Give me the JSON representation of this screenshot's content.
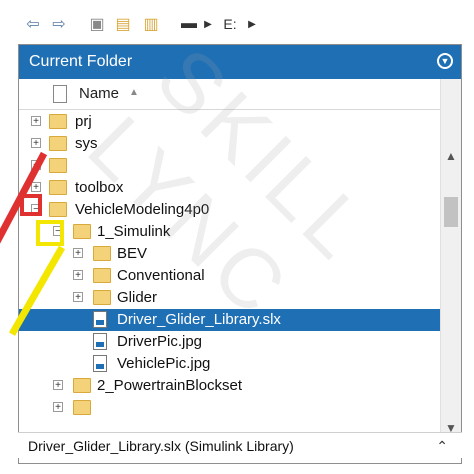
{
  "toolbar": {
    "back_icon": "back-arrow",
    "forward_icon": "forward-arrow",
    "up_icon": "folder-up",
    "browse_icon": "browse-folder",
    "search_icon": "search-folder",
    "drive_icon": "drive",
    "path_label": "E:"
  },
  "panel": {
    "title": "Current Folder",
    "column_header": "Name"
  },
  "tree": [
    {
      "label": "prj",
      "level": 1,
      "type": "folder",
      "expander": "+"
    },
    {
      "label": "sys",
      "level": 1,
      "type": "folder",
      "expander": "+"
    },
    {
      "label": "",
      "level": 1,
      "type": "folder",
      "expander": "+"
    },
    {
      "label": "toolbox",
      "level": 1,
      "type": "folder",
      "expander": "+"
    },
    {
      "label": "VehicleModeling4p0",
      "level": 1,
      "type": "folder",
      "expander": "−"
    },
    {
      "label": "1_Simulink",
      "level": 2,
      "type": "folder",
      "expander": "−"
    },
    {
      "label": "BEV",
      "level": 3,
      "type": "folder",
      "expander": "+"
    },
    {
      "label": "Conventional",
      "level": 3,
      "type": "folder",
      "expander": "+"
    },
    {
      "label": "Glider",
      "level": 3,
      "type": "folder",
      "expander": "+"
    },
    {
      "label": "Driver_Glider_Library.slx",
      "level": 3,
      "type": "file",
      "selected": true
    },
    {
      "label": "DriverPic.jpg",
      "level": 3,
      "type": "file"
    },
    {
      "label": "VehiclePic.jpg",
      "level": 3,
      "type": "file"
    },
    {
      "label": "2_PowertrainBlockset",
      "level": 2,
      "type": "folder",
      "expander": "+"
    },
    {
      "label": "",
      "level": 2,
      "type": "folder",
      "expander": "+"
    }
  ],
  "status": {
    "text": "Driver_Glider_Library.slx  (Simulink Library)"
  },
  "watermark": "SKILL LYNC",
  "colors": {
    "accent": "#1f6fb5",
    "highlight_red": "#e03131",
    "highlight_yellow": "#f3e600"
  }
}
